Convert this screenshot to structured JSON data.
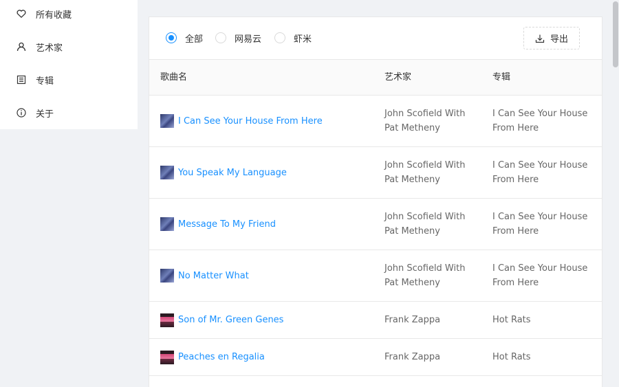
{
  "sidebar": {
    "items": [
      {
        "label": "所有收藏",
        "icon": "heart-icon"
      },
      {
        "label": "艺术家",
        "icon": "user-icon"
      },
      {
        "label": "专辑",
        "icon": "album-icon"
      },
      {
        "label": "关于",
        "icon": "info-icon"
      }
    ]
  },
  "filters": {
    "options": [
      {
        "label": "全部",
        "checked": true
      },
      {
        "label": "网易云",
        "checked": false
      },
      {
        "label": "虾米",
        "checked": false
      }
    ],
    "export_label": "导出"
  },
  "table": {
    "headers": {
      "song": "歌曲名",
      "artist": "艺术家",
      "album": "专辑"
    },
    "rows": [
      {
        "song": "I Can See Your House From Here",
        "artist_line1": "John Scofield With",
        "artist_line2": "Pat Metheny",
        "album_line1": "I Can See Your House",
        "album_line2": "From Here",
        "cover": "blue"
      },
      {
        "song": "You Speak My Language",
        "artist_line1": "John Scofield With",
        "artist_line2": "Pat Metheny",
        "album_line1": "I Can See Your House",
        "album_line2": "From Here",
        "cover": "blue"
      },
      {
        "song": "Message To My Friend",
        "artist_line1": "John Scofield With",
        "artist_line2": "Pat Metheny",
        "album_line1": "I Can See Your House",
        "album_line2": "From Here",
        "cover": "blue"
      },
      {
        "song": "No Matter What",
        "artist_line1": "John Scofield With",
        "artist_line2": "Pat Metheny",
        "album_line1": "I Can See Your House",
        "album_line2": "From Here",
        "cover": "blue"
      },
      {
        "song": "Son of Mr. Green Genes",
        "artist_line1": "Frank Zappa",
        "artist_line2": "",
        "album_line1": "Hot Rats",
        "album_line2": "",
        "cover": "pink"
      },
      {
        "song": "Peaches en Regalia",
        "artist_line1": "Frank Zappa",
        "artist_line2": "",
        "album_line1": "Hot Rats",
        "album_line2": "",
        "cover": "pink"
      }
    ]
  },
  "colors": {
    "accent": "#1890ff",
    "background": "#f0f2f5",
    "text": "#333333",
    "muted_text": "#666666"
  }
}
